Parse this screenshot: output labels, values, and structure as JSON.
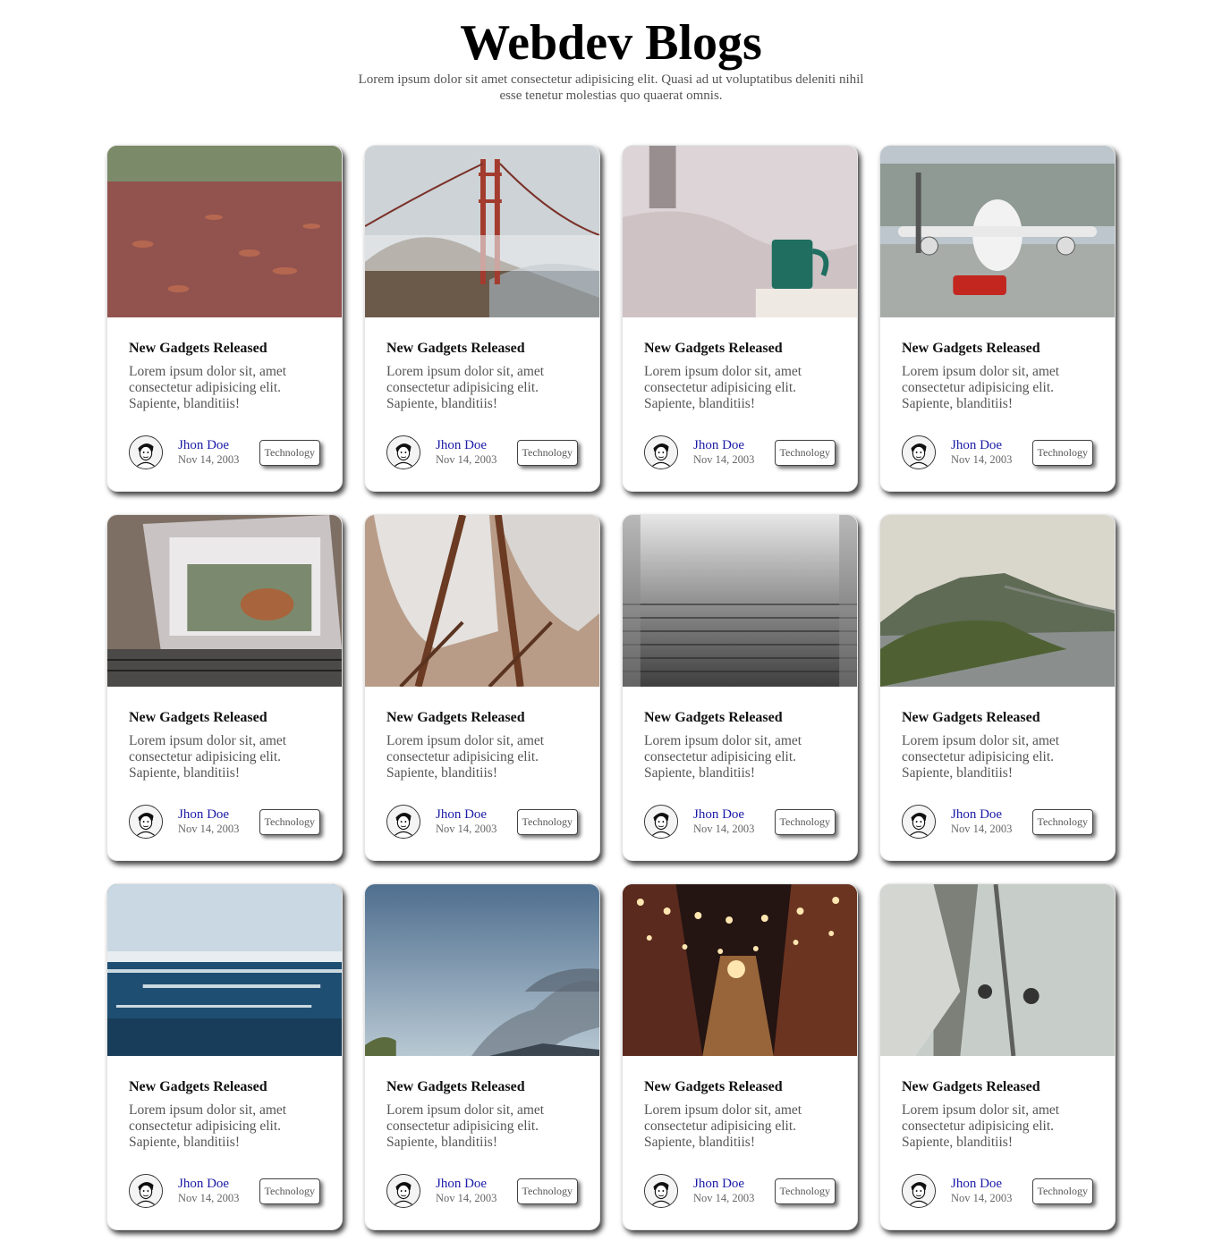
{
  "header": {
    "title": "Webdev Blogs",
    "subtitle": "Lorem ipsum dolor sit amet consectetur adipisicing elit. Quasi ad ut voluptatibus deleniti nihil esse tenetur molestias quo quaerat omnis."
  },
  "cards": [
    {
      "image": "autumn-leaves-path",
      "title": "New Gadgets Released",
      "text": "Lorem ipsum dolor sit, amet consectetur adipisicing elit. Sapiente, blanditiis!",
      "author": "Jhon Doe",
      "date": "Nov 14, 2003",
      "tag": "Technology"
    },
    {
      "image": "golden-gate-bridge-fog",
      "title": "New Gadgets Released",
      "text": "Lorem ipsum dolor sit, amet consectetur adipisicing elit. Sapiente, blanditiis!",
      "author": "Jhon Doe",
      "date": "Nov 14, 2003",
      "tag": "Technology"
    },
    {
      "image": "coffee-mug-bed",
      "title": "New Gadgets Released",
      "text": "Lorem ipsum dolor sit, amet consectetur adipisicing elit. Sapiente, blanditiis!",
      "author": "Jhon Doe",
      "date": "Nov 14, 2003",
      "tag": "Technology"
    },
    {
      "image": "airplane-on-tarmac",
      "title": "New Gadgets Released",
      "text": "Lorem ipsum dolor sit, amet consectetur adipisicing elit. Sapiente, blanditiis!",
      "author": "Jhon Doe",
      "date": "Nov 14, 2003",
      "tag": "Technology"
    },
    {
      "image": "laptop-horse-photo",
      "title": "New Gadgets Released",
      "text": "Lorem ipsum dolor sit, amet consectetur adipisicing elit. Sapiente, blanditiis!",
      "author": "Jhon Doe",
      "date": "Nov 14, 2003",
      "tag": "Technology"
    },
    {
      "image": "white-chairs",
      "title": "New Gadgets Released",
      "text": "Lorem ipsum dolor sit, amet consectetur adipisicing elit. Sapiente, blanditiis!",
      "author": "Jhon Doe",
      "date": "Nov 14, 2003",
      "tag": "Technology"
    },
    {
      "image": "foggy-stairs",
      "title": "New Gadgets Released",
      "text": "Lorem ipsum dolor sit, amet consectetur adipisicing elit. Sapiente, blanditiis!",
      "author": "Jhon Doe",
      "date": "Nov 14, 2003",
      "tag": "Technology"
    },
    {
      "image": "coastal-mountains",
      "title": "New Gadgets Released",
      "text": "Lorem ipsum dolor sit, amet consectetur adipisicing elit. Sapiente, blanditiis!",
      "author": "Jhon Doe",
      "date": "Nov 14, 2003",
      "tag": "Technology"
    },
    {
      "image": "ocean-waves",
      "title": "New Gadgets Released",
      "text": "Lorem ipsum dolor sit, amet consectetur adipisicing elit. Sapiente, blanditiis!",
      "author": "Jhon Doe",
      "date": "Nov 14, 2003",
      "tag": "Technology"
    },
    {
      "image": "blue-sky-clouds",
      "title": "New Gadgets Released",
      "text": "Lorem ipsum dolor sit, amet consectetur adipisicing elit. Sapiente, blanditiis!",
      "author": "Jhon Doe",
      "date": "Nov 14, 2003",
      "tag": "Technology"
    },
    {
      "image": "night-street-lights",
      "title": "New Gadgets Released",
      "text": "Lorem ipsum dolor sit, amet consectetur adipisicing elit. Sapiente, blanditiis!",
      "author": "Jhon Doe",
      "date": "Nov 14, 2003",
      "tag": "Technology"
    },
    {
      "image": "sailboat-mast",
      "title": "New Gadgets Released",
      "text": "Lorem ipsum dolor sit, amet consectetur adipisicing elit. Sapiente, blanditiis!",
      "author": "Jhon Doe",
      "date": "Nov 14, 2003",
      "tag": "Technology"
    }
  ],
  "colors": {
    "author_link": "#1a1aa6",
    "muted_text": "#555555"
  }
}
